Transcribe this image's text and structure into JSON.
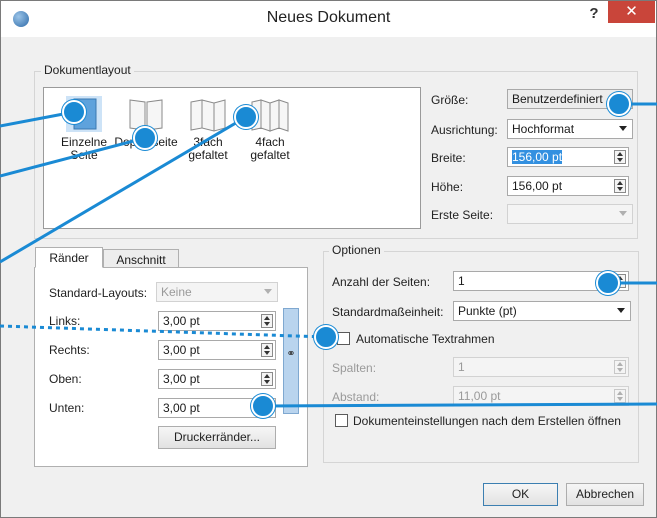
{
  "window": {
    "title": "Neues Dokument",
    "help_label": "?",
    "close_label": "✕"
  },
  "layout_group": {
    "title": "Dokumentlayout",
    "items": [
      {
        "label": "Einzelne Seite",
        "icon": "single-page-icon",
        "selected": true
      },
      {
        "label": "Doppelseite",
        "icon": "double-page-icon",
        "selected": false
      },
      {
        "label": "3fach gefaltet",
        "icon": "trifold-icon",
        "selected": false
      },
      {
        "label": "4fach gefaltet",
        "icon": "fourfold-icon",
        "selected": false
      }
    ],
    "size_label": "Größe:",
    "size_value": "Benutzerdefiniert",
    "orientation_label": "Ausrichtung:",
    "orientation_value": "Hochformat",
    "width_label": "Breite:",
    "width_value": "156,00 pt",
    "height_label": "Höhe:",
    "height_value": "156,00 pt",
    "first_page_label": "Erste Seite:",
    "first_page_value": ""
  },
  "margins": {
    "tab_margins": "Ränder",
    "tab_bleed": "Anschnitt",
    "presets_label": "Standard-Layouts:",
    "presets_value": "Keine",
    "left_label": "Links:",
    "left_value": "3,00 pt",
    "right_label": "Rechts:",
    "right_value": "3,00 pt",
    "top_label": "Oben:",
    "top_value": "3,00 pt",
    "bottom_label": "Unten:",
    "bottom_value": "3,00 pt",
    "printer_margins_button": "Druckerränder...",
    "chain_icon": "chain-link-icon"
  },
  "options": {
    "title": "Optionen",
    "pages_label": "Anzahl der Seiten:",
    "pages_value": "1",
    "unit_label": "Standardmaßeinheit:",
    "unit_value": "Punkte (pt)",
    "auto_frames_label": "Automatische Textrahmen",
    "columns_label": "Spalten:",
    "columns_value": "1",
    "gap_label": "Abstand:",
    "gap_value": "11,00 pt",
    "open_settings_label": "Dokumenteinstellungen nach dem Erstellen öffnen"
  },
  "footer": {
    "ok_label": "OK",
    "cancel_label": "Abbrechen"
  },
  "colors": {
    "accent": "#1a8ad4",
    "close": "#c9453a",
    "selection": "#3390e0"
  }
}
